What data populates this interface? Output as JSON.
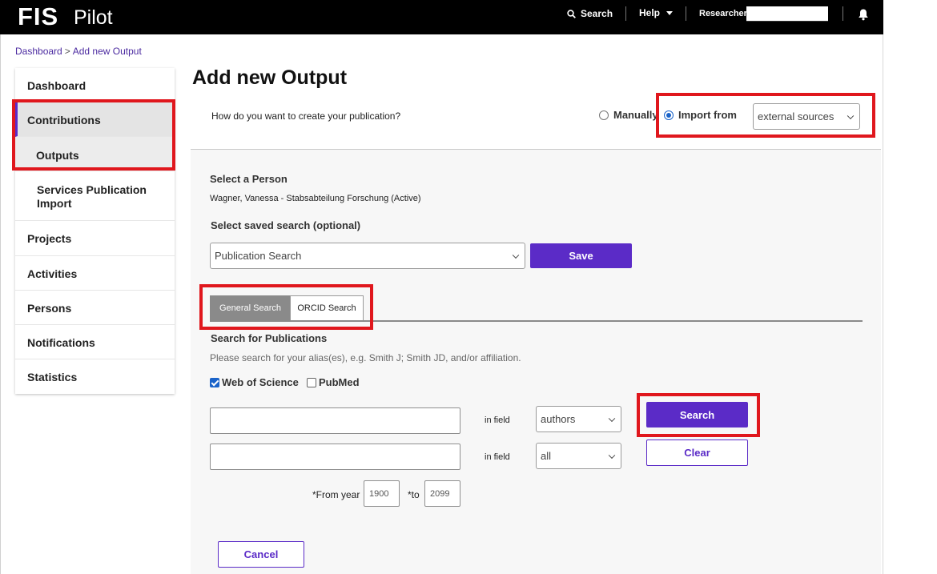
{
  "topbar": {
    "logo_main": "FIS",
    "logo_sub": "Pilot",
    "search_label": "Search",
    "help_label": "Help",
    "researcher_label": "Researcher:"
  },
  "breadcrumb": {
    "items": [
      "Dashboard",
      "Add new Output"
    ],
    "separator": ">"
  },
  "sidebar": {
    "items": [
      {
        "label": "Dashboard"
      },
      {
        "label": "Contributions"
      },
      {
        "label": "Outputs"
      },
      {
        "label": "Services Publication Import"
      },
      {
        "label": "Projects"
      },
      {
        "label": "Activities"
      },
      {
        "label": "Persons"
      },
      {
        "label": "Notifications"
      },
      {
        "label": "Statistics"
      }
    ]
  },
  "page": {
    "title": "Add new Output",
    "question": "How do you want to create your publication?",
    "option_manual": "Manually",
    "option_import": "Import from",
    "import_source": "external sources"
  },
  "person": {
    "heading": "Select a Person",
    "value": "Wagner, Vanessa - Stabsabteilung Forschung (Active)"
  },
  "saved_search": {
    "heading": "Select saved search (optional)",
    "value": "Publication Search",
    "save_label": "Save"
  },
  "tabs": [
    {
      "label": "General Search",
      "active": true
    },
    {
      "label": "ORCID Search",
      "active": false
    }
  ],
  "search": {
    "heading": "Search for Publications",
    "hint": "Please search for your alias(es), e.g. Smith J; Smith JD, and/or affiliation.",
    "sources": [
      {
        "label": "Web of Science",
        "checked": true
      },
      {
        "label": "PubMed",
        "checked": false
      }
    ],
    "rows": [
      {
        "in_field_label": "in field",
        "field_value": "authors"
      },
      {
        "in_field_label": "in field",
        "field_value": "all"
      }
    ],
    "search_label": "Search",
    "clear_label": "Clear",
    "from_year_label": "*From year",
    "from_year": "1900",
    "to_label": "*to",
    "to_year": "2099"
  },
  "cancel_label": "Cancel",
  "colors": {
    "accent": "#5b2bc7",
    "highlight_box": "#e0171d",
    "topbar": "#000000"
  }
}
